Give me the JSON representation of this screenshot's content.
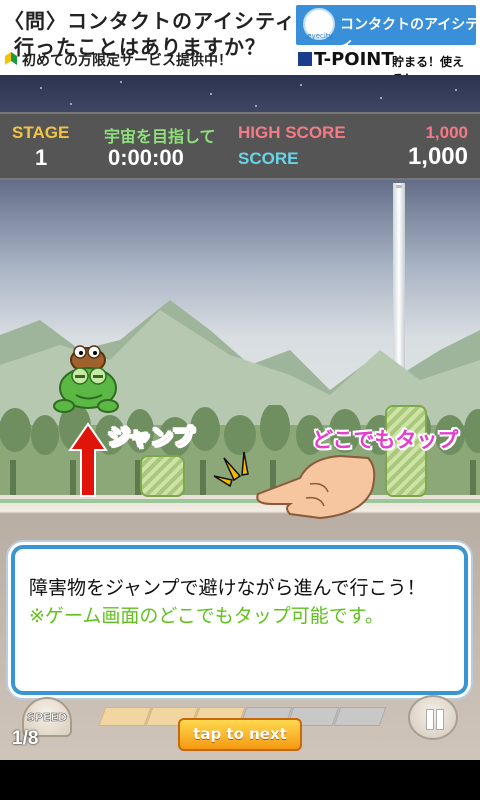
{
  "ad": {
    "line1": "〈問〉コンタクトのアイシティに",
    "line2": "行ったことはありますか？",
    "line3": "初めての方限定サービス提供中！",
    "logo_text": "eyecity",
    "brand": "コンタクトのアイシティ",
    "tpoint": "T-POINT",
    "tpoint_sub": "貯まる！使える！"
  },
  "hud": {
    "stage_label": "STAGE",
    "stage_value": "1",
    "goal_label": "宇宙を目指して",
    "time_value": "0:00:00",
    "high_score_label": "HIGH SCORE",
    "high_score_value": "1,000",
    "score_label": "SCORE",
    "score_value": "1,000"
  },
  "tutorial": {
    "jump_label": "ジャンプ",
    "tap_label": "どこでもタップ"
  },
  "dialog": {
    "line1": "障害物をジャンプで避けながら進んで行こう！",
    "line2": "※ゲーム画面のどこでもタップ可能です。"
  },
  "controls": {
    "speed_label": "SPEED",
    "speed_level": 3,
    "speed_max": 6,
    "page_indicator": "1/8",
    "next_button": "tap to next"
  },
  "colors": {
    "stage_label": "#f5c343",
    "goal_label": "#8fe07a",
    "high_score": "#f47a86",
    "score_label": "#69d3e8",
    "jump_label": "#ff2a1a",
    "tap_label": "#e33fcf",
    "dialog_border": "#3a95d4",
    "dialog_note": "#60c21e"
  }
}
